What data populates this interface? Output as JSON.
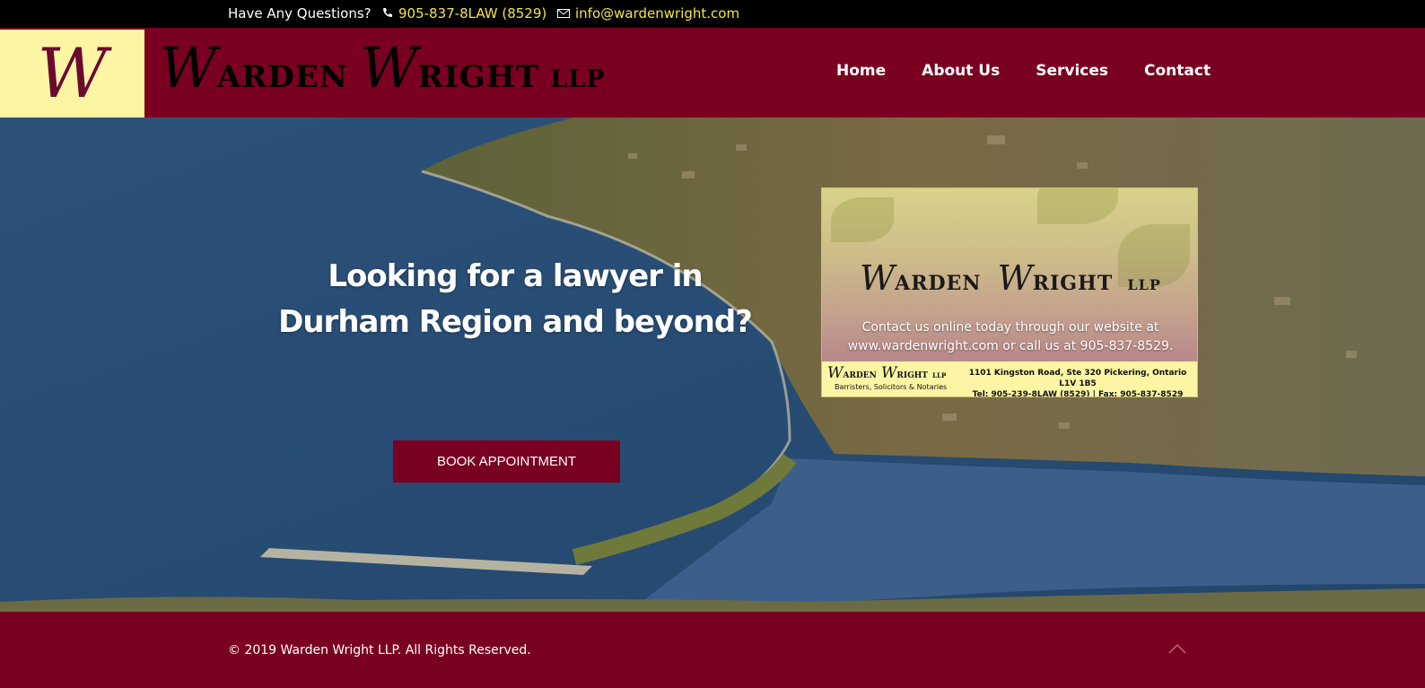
{
  "topbar": {
    "question": "Have Any Questions?",
    "phone": "905-837-8LAW (8529)",
    "email": "info@wardenwright.com",
    "phone_icon": "phone-icon",
    "mail_icon": "mail-icon"
  },
  "header": {
    "logo_letter": "W",
    "brand_part1_initial": "W",
    "brand_part1_rest": "ARDEN",
    "brand_part2_initial": "W",
    "brand_part2_rest": "RIGHT",
    "brand_suffix": "LLP"
  },
  "nav": {
    "home": "Home",
    "about": "About Us",
    "services": "Services",
    "contact": "Contact"
  },
  "hero": {
    "title_line1": "Looking for a lawyer in",
    "title_line2": "Durham Region and beyond?",
    "book_button": "BOOK APPOINTMENT"
  },
  "card": {
    "brand_part1_initial": "W",
    "brand_part1_rest": "ARDEN",
    "brand_part2_initial": "W",
    "brand_part2_rest": "RIGHT",
    "brand_suffix": "LLP",
    "text_line1": "Contact us online today through our website at",
    "text_line2": "www.wardenwright.com or call us at 905-837-8529.",
    "footer_subtitle": "Barristers, Solicitors & Notaries",
    "address_line1": "1101 Kingston Road, Ste 320 Pickering, Ontario L1V 1B5",
    "address_line2": "Tel: 905-239-8LAW (8529) | Fax: 905-837-8529"
  },
  "footer": {
    "copyright": "© 2019 Warden Wright LLP. All Rights Reserved.",
    "to_top_icon": "chevron-up-icon"
  },
  "colors": {
    "brand_maroon": "#7a0022",
    "logo_yellow": "#fbf5a4",
    "accent_yellow": "#f4e24a",
    "topbar_black": "#000000"
  }
}
